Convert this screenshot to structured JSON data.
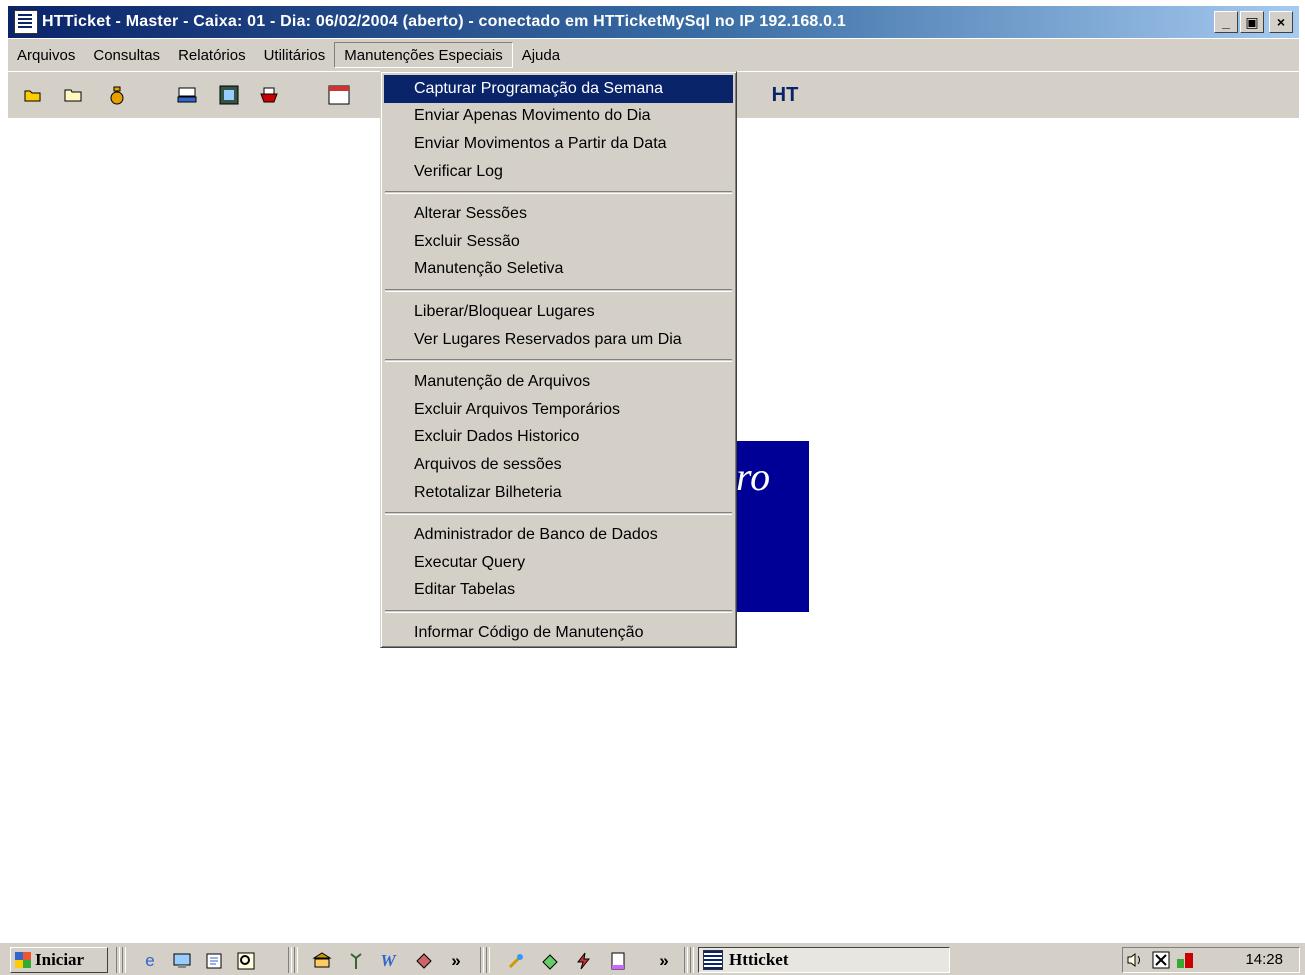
{
  "window": {
    "title": "HTTicket  - Master - Caixa: 01 -  Dia: 06/02/2004  (aberto) - conectado em HTTicketMySql  no IP  192.168.0.1",
    "buttons": {
      "minimize": "_",
      "maximize": "▣",
      "close": "×"
    }
  },
  "menubar": {
    "items": [
      "Arquivos",
      "Consultas",
      "Relatórios",
      "Utilitários",
      "Manutenções Especiais",
      "Ajuda"
    ],
    "open_index": 4
  },
  "toolbar": {
    "icons": [
      "open-folder-icon",
      "folder-icon",
      "money-bag-icon",
      "cash-register-icon",
      "film-icon",
      "printer-icon",
      "calendar-icon"
    ],
    "logo_text": "HT"
  },
  "dropdown": {
    "groups": [
      [
        "Capturar Programação da Semana",
        "Enviar Apenas Movimento do Dia",
        "Enviar Movimentos a Partir da Data",
        "Verificar Log"
      ],
      [
        "Alterar Sessões",
        "Excluir Sessão",
        "Manutenção Seletiva"
      ],
      [
        "Liberar/Bloquear Lugares",
        "Ver Lugares Reservados para um Dia"
      ],
      [
        "Manutenção de Arquivos",
        "Excluir Arquivos Temporários",
        "Excluir Dados Historico",
        "Arquivos de sessões",
        "Retotalizar Bilheteria"
      ],
      [
        "Administrador de Banco de Dados",
        "Executar Query",
        "Editar Tabelas"
      ],
      [
        "Informar Código de Manutenção"
      ]
    ],
    "selected": "Capturar Programação da Semana"
  },
  "background_logo": {
    "text": "ro",
    "color": "#000096"
  },
  "taskbar": {
    "start_label": "Iniciar",
    "chevron": "»",
    "task_button": "Htticket",
    "clock": "14:28"
  },
  "colors": {
    "highlight": "#0a246a",
    "face": "#d4d0c8",
    "logo_bg": "#000096"
  }
}
